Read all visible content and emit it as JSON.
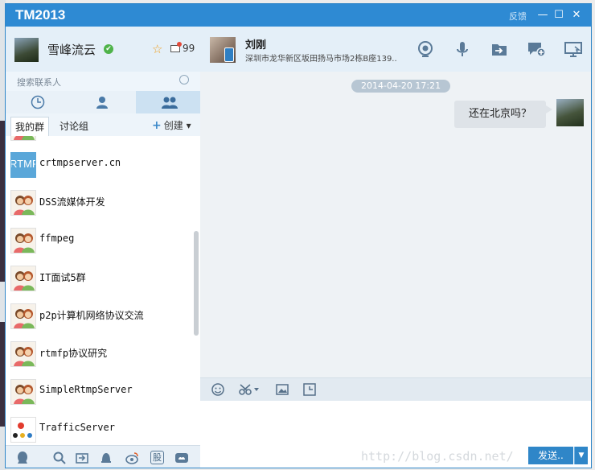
{
  "window": {
    "title": "TM2013",
    "feedback_label": "反馈",
    "minimize_glyph": "—",
    "maximize_glyph": "☐",
    "close_glyph": "✕"
  },
  "profile": {
    "name": "雪峰流云",
    "status": "online",
    "message_count": "99"
  },
  "search": {
    "placeholder": "搜索联系人"
  },
  "contact_tabs": [
    "recent-contacts",
    "friends",
    "groups"
  ],
  "sub_tabs": {
    "my_groups": "我的群",
    "discussion": "讨论组",
    "create": "创建"
  },
  "groups": [
    {
      "name": "crtmpserver.cn",
      "icon": "rtmp-logo",
      "icon_text": "RTMP"
    },
    {
      "name": "DSS流媒体开发",
      "icon": "group-icon"
    },
    {
      "name": "ffmpeg",
      "icon": "group-icon"
    },
    {
      "name": "IT面试5群",
      "icon": "group-icon"
    },
    {
      "name": "p2p计算机网络协议交流",
      "icon": "group-icon"
    },
    {
      "name": "rtmfp协议研究",
      "icon": "group-icon"
    },
    {
      "name": "SimpleRtmpServer",
      "icon": "group-icon"
    },
    {
      "name": "TrafficServer",
      "icon": "ts-logo"
    }
  ],
  "bottom_bar": {
    "stock_label": "股"
  },
  "chat": {
    "peer_name": "刘刚",
    "peer_signature": "深圳市龙华新区坂田扬马市场2栋B座139..",
    "timestamp": "2014-04-20 17:21",
    "messages": [
      {
        "from": "me",
        "text": "还在北京吗？"
      }
    ],
    "send_label": "发送..",
    "watermark": "http://blog.csdn.net/"
  },
  "colors": {
    "titlebar": "#2e8ad3",
    "panel": "#e4eff8",
    "chat_bg": "#eef2f5",
    "send": "#2f86c8"
  }
}
